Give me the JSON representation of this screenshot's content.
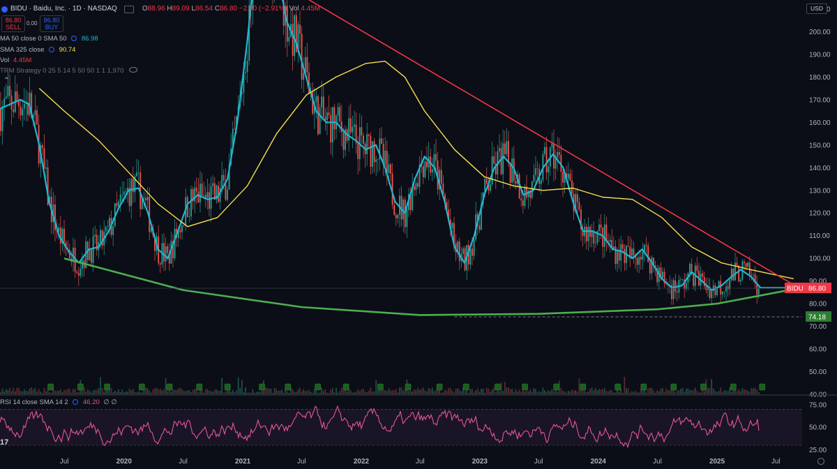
{
  "header": {
    "symbol_title": "BIDU · Baidu, Inc. · 1D · NASDAQ",
    "ohlc": [
      {
        "label": "O",
        "value": "88.96"
      },
      {
        "label": "H",
        "value": "89.09"
      },
      {
        "label": "L",
        "value": "86.54"
      },
      {
        "label": "C",
        "value": "86.80"
      },
      {
        "label": "",
        "value": "−2.60 (−2.91%)"
      }
    ],
    "vol_label": "Vol",
    "vol_value": "4.45M"
  },
  "trade": {
    "sell_price": "86.80",
    "sell_label": "SELL",
    "buy_price": "86.80",
    "buy_label": "BUY",
    "spread": "0.00"
  },
  "indicators": [
    {
      "name": "MA 50 close 0 SMA 50",
      "value": "86.98",
      "color": "#22b5d4"
    },
    {
      "name": "SMA 325 close",
      "value": "90.74",
      "color": "#f7e14d"
    },
    {
      "name": "Vol",
      "value": "4.45M",
      "color": "#f23645"
    },
    {
      "name": "TRM Strategy 0 25 5 14 5 50 50 1 1 1,970",
      "value": "",
      "color": "#787b86"
    }
  ],
  "currency": "USD",
  "rsi": {
    "name": "RSI 14 close SMA 14 2",
    "value": "46.20",
    "extra": "∅ ∅",
    "color": "#e8559a"
  },
  "tv_logo": "17",
  "colors": {
    "price_line": "#22b5d4",
    "sma325": "#f7e14d",
    "resistance": "#f23645",
    "support": "#4caf50",
    "rsi": "#e8559a",
    "bull": "#26a69a",
    "bear": "#ef5350"
  },
  "chart_data": {
    "type": "line",
    "price_axis": {
      "ticks": [
        40,
        50,
        60,
        70,
        80,
        90,
        100,
        110,
        120,
        130,
        140,
        150,
        160,
        170,
        180,
        190,
        200,
        210
      ],
      "tick_labels": [
        "40.00",
        "50.00",
        "60.00",
        "70.00",
        "80.00",
        "90.00",
        "100.00",
        "110.00",
        "120.00",
        "130.00",
        "140.00",
        "150.00",
        "160.00",
        "170.00",
        "180.00",
        "190.00",
        "200.00",
        "210.00"
      ],
      "range": [
        40,
        214
      ]
    },
    "time_axis": {
      "labels": [
        "Jul",
        "2020",
        "Jul",
        "2021",
        "Jul",
        "2022",
        "Jul",
        "2023",
        "Jul",
        "2024",
        "Jul",
        "2025",
        "Jul"
      ],
      "dates": [
        "2019-07-01",
        "2020-01-01",
        "2020-07-01",
        "2021-01-01",
        "2021-07-01",
        "2022-01-01",
        "2022-07-01",
        "2023-01-01",
        "2023-07-01",
        "2024-01-01",
        "2024-07-01",
        "2025-01-01",
        "2025-07-01"
      ],
      "range": [
        "2018-12-15",
        "2025-09-20"
      ]
    },
    "series": [
      {
        "name": "MA 50 close 0 SMA 50",
        "color": "#22b5d4",
        "points": [
          [
            "2018-12-15",
            166
          ],
          [
            "2019-01-15",
            168
          ],
          [
            "2019-02-15",
            170
          ],
          [
            "2019-03-15",
            168
          ],
          [
            "2019-04-15",
            150
          ],
          [
            "2019-05-15",
            125
          ],
          [
            "2019-06-15",
            110
          ],
          [
            "2019-07-15",
            103
          ],
          [
            "2019-08-15",
            98
          ],
          [
            "2019-09-15",
            104
          ],
          [
            "2019-10-15",
            105
          ],
          [
            "2019-11-15",
            112
          ],
          [
            "2019-12-15",
            122
          ],
          [
            "2020-01-15",
            130
          ],
          [
            "2020-02-15",
            131
          ],
          [
            "2020-03-15",
            120
          ],
          [
            "2020-04-15",
            104
          ],
          [
            "2020-05-15",
            100
          ],
          [
            "2020-06-15",
            112
          ],
          [
            "2020-07-15",
            124
          ],
          [
            "2020-08-15",
            128
          ],
          [
            "2020-09-15",
            126
          ],
          [
            "2020-10-15",
            127
          ],
          [
            "2020-11-15",
            135
          ],
          [
            "2020-12-15",
            160
          ],
          [
            "2021-01-15",
            196
          ],
          [
            "2021-02-15",
            240
          ],
          [
            "2021-03-15",
            245
          ],
          [
            "2021-04-15",
            230
          ],
          [
            "2021-05-15",
            205
          ],
          [
            "2021-06-15",
            195
          ],
          [
            "2021-07-15",
            180
          ],
          [
            "2021-08-15",
            165
          ],
          [
            "2021-09-15",
            160
          ],
          [
            "2021-10-15",
            160
          ],
          [
            "2021-11-15",
            155
          ],
          [
            "2021-12-15",
            152
          ],
          [
            "2022-01-15",
            148
          ],
          [
            "2022-02-15",
            150
          ],
          [
            "2022-03-15",
            140
          ],
          [
            "2022-04-15",
            125
          ],
          [
            "2022-05-15",
            120
          ],
          [
            "2022-06-15",
            135
          ],
          [
            "2022-07-15",
            145
          ],
          [
            "2022-08-15",
            140
          ],
          [
            "2022-09-15",
            125
          ],
          [
            "2022-10-15",
            105
          ],
          [
            "2022-11-15",
            98
          ],
          [
            "2022-12-15",
            110
          ],
          [
            "2023-01-15",
            128
          ],
          [
            "2023-02-15",
            140
          ],
          [
            "2023-03-15",
            145
          ],
          [
            "2023-04-15",
            140
          ],
          [
            "2023-05-15",
            128
          ],
          [
            "2023-06-15",
            130
          ],
          [
            "2023-07-15",
            140
          ],
          [
            "2023-08-15",
            146
          ],
          [
            "2023-09-15",
            140
          ],
          [
            "2023-10-15",
            125
          ],
          [
            "2023-11-15",
            112
          ],
          [
            "2023-12-15",
            112
          ],
          [
            "2024-01-15",
            110
          ],
          [
            "2024-02-15",
            104
          ],
          [
            "2024-03-15",
            103
          ],
          [
            "2024-04-15",
            100
          ],
          [
            "2024-05-15",
            104
          ],
          [
            "2024-06-15",
            98
          ],
          [
            "2024-07-15",
            91
          ],
          [
            "2024-08-15",
            87
          ],
          [
            "2024-09-15",
            88
          ],
          [
            "2024-10-15",
            94
          ],
          [
            "2024-11-15",
            90
          ],
          [
            "2024-12-15",
            86
          ],
          [
            "2025-01-15",
            88
          ],
          [
            "2025-02-15",
            92
          ],
          [
            "2025-03-15",
            95
          ],
          [
            "2025-04-15",
            92
          ],
          [
            "2025-05-15",
            87
          ],
          [
            "2025-06-15",
            87
          ],
          [
            "2025-07-15",
            87
          ],
          [
            "2025-08-25",
            87
          ]
        ]
      },
      {
        "name": "SMA 325 close",
        "color": "#f7e14d",
        "points": [
          [
            "2019-04-15",
            175
          ],
          [
            "2019-07-01",
            165
          ],
          [
            "2019-10-15",
            152
          ],
          [
            "2020-01-15",
            138
          ],
          [
            "2020-04-15",
            124
          ],
          [
            "2020-07-15",
            114
          ],
          [
            "2020-10-15",
            118
          ],
          [
            "2021-01-15",
            132
          ],
          [
            "2021-04-15",
            155
          ],
          [
            "2021-07-15",
            172
          ],
          [
            "2021-10-15",
            180
          ],
          [
            "2022-01-15",
            186
          ],
          [
            "2022-03-15",
            187
          ],
          [
            "2022-05-15",
            180
          ],
          [
            "2022-07-15",
            165
          ],
          [
            "2022-10-15",
            148
          ],
          [
            "2023-01-15",
            136
          ],
          [
            "2023-04-15",
            132
          ],
          [
            "2023-07-15",
            130
          ],
          [
            "2023-10-15",
            131
          ],
          [
            "2024-01-15",
            127
          ],
          [
            "2024-04-15",
            126
          ],
          [
            "2024-07-15",
            118
          ],
          [
            "2024-10-15",
            105
          ],
          [
            "2025-01-15",
            98
          ],
          [
            "2025-04-15",
            95
          ],
          [
            "2025-08-25",
            91
          ]
        ]
      },
      {
        "name": "",
        "color": "#f23645",
        "points": [
          [
            "2021-07-01",
            216
          ],
          [
            "2025-09-10",
            87
          ]
        ]
      },
      {
        "name": "",
        "color": "#4caf50",
        "points": [
          [
            "2019-07-01",
            100
          ],
          [
            "2020-07-01",
            86
          ],
          [
            "2021-07-01",
            78.5
          ],
          [
            "2022-07-01",
            75
          ],
          [
            "2023-07-01",
            75.5
          ],
          [
            "2024-07-01",
            77.5
          ],
          [
            "2025-01-01",
            80
          ],
          [
            "2025-09-10",
            86.8
          ]
        ]
      }
    ],
    "last_price": {
      "label": "BIDU",
      "value": "86.80",
      "price": 86.8
    },
    "support_level": {
      "value": "74.18",
      "price": 74.18
    },
    "rsi": {
      "name": "RSI 14 close SMA 14 2",
      "value": 46.2,
      "ticks": [
        25,
        50,
        75
      ],
      "tick_labels": [
        "25.00",
        "50.00",
        "75.00"
      ],
      "range": [
        20,
        85
      ],
      "band": [
        30,
        70
      ]
    },
    "grid": false,
    "legend": "top-left"
  }
}
